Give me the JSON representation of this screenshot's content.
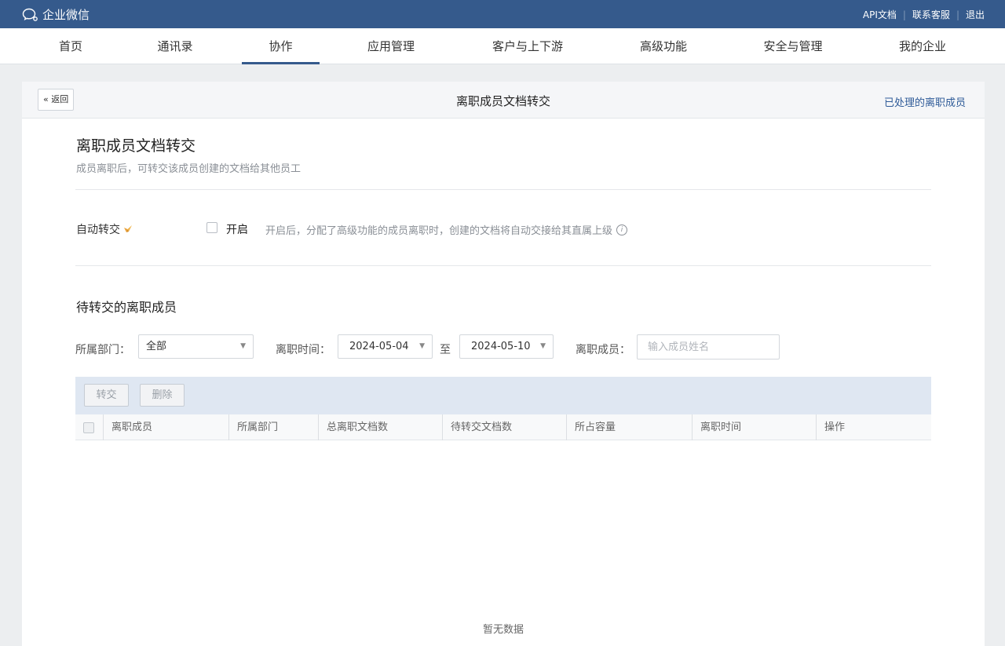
{
  "app": {
    "name": "企业微信",
    "toplinks": [
      "API文档",
      "联系客服",
      "退出"
    ]
  },
  "nav": {
    "items": [
      "首页",
      "通讯录",
      "协作",
      "应用管理",
      "客户与上下游",
      "高级功能",
      "安全与管理",
      "我的企业"
    ],
    "active": "协作"
  },
  "header": {
    "back_label": "« 返回",
    "title": "离职成员文档转交",
    "processed_link": "已处理的离职成员"
  },
  "section": {
    "title": "离职成员文档转交",
    "description": "成员离职后，可转交该成员创建的文档给其他员工"
  },
  "auto_transfer": {
    "label": "自动转交",
    "enable_label": "开启",
    "checked": false,
    "description": "开启后，分配了高级功能的成员离职时，创建的文档将自动交接给其直属上级"
  },
  "pending": {
    "title": "待转交的离职成员"
  },
  "filters": {
    "department_label": "所属部门：",
    "department_value": "全部",
    "time_label": "离职时间：",
    "start_date": "2024-05-04",
    "to_label": "至",
    "end_date": "2024-05-10",
    "member_label": "离职成员：",
    "member_placeholder": "输入成员姓名"
  },
  "toolbar": {
    "transfer_label": "转交",
    "delete_label": "删除"
  },
  "table": {
    "columns": [
      "离职成员",
      "所属部门",
      "总离职文档数",
      "待转交文档数",
      "所占容量",
      "离职时间",
      "操作"
    ],
    "rows": [],
    "empty_text": "暂无数据"
  },
  "colors": {
    "topbar": "#355a8c",
    "toolbar_bg": "#dfe7f2",
    "link": "#2f5b98"
  }
}
